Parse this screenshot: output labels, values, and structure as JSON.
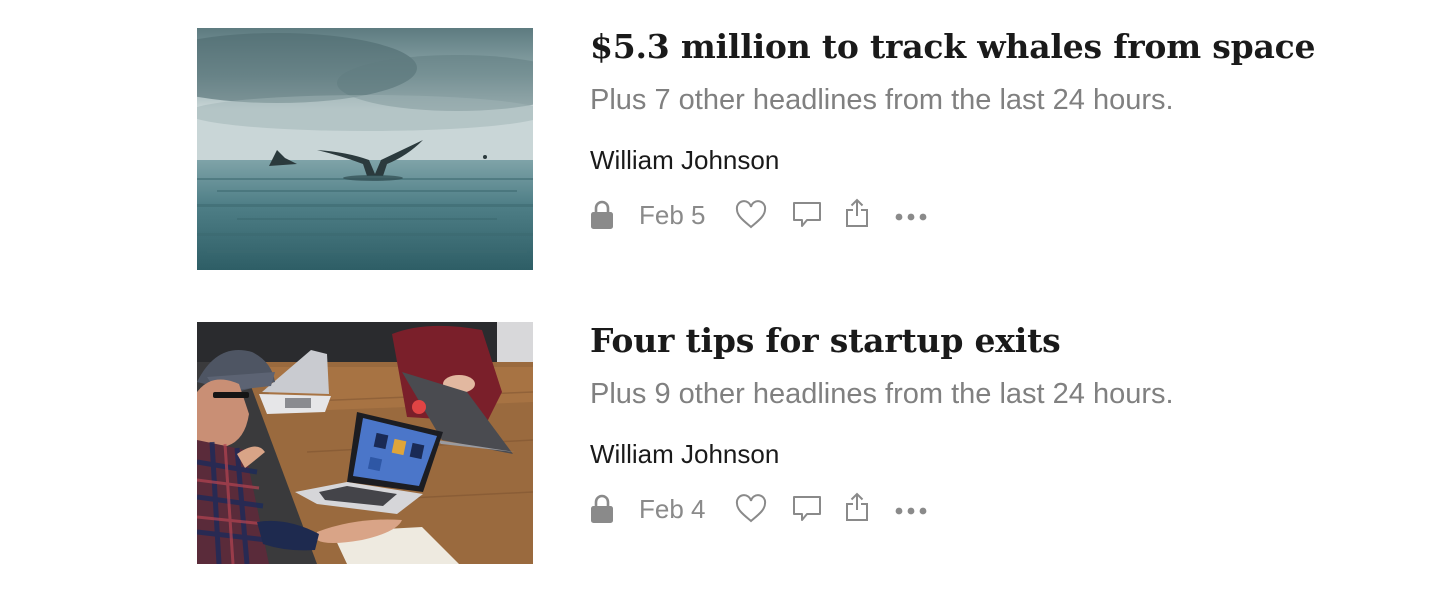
{
  "posts": [
    {
      "title": "$5.3 million to track whales from space",
      "subtitle": "Plus 7 other headlines from the last 24 hours.",
      "author": "William Johnson",
      "date": "Feb 5",
      "thumbnail": "whale-tail-photo"
    },
    {
      "title": "Four tips for startup exits",
      "subtitle": "Plus 9 other headlines from the last 24 hours.",
      "author": "William Johnson",
      "date": "Feb 4",
      "thumbnail": "meeting-laptops-photo"
    }
  ],
  "icons": {
    "lock": "lock-icon",
    "like": "heart-icon",
    "comment": "comment-icon",
    "share": "share-icon",
    "more": "more-icon"
  },
  "colors": {
    "title": "#1a1a1a",
    "subtitle": "#808080",
    "meta": "#8a8a8a",
    "icon": "#8a8a8a"
  }
}
